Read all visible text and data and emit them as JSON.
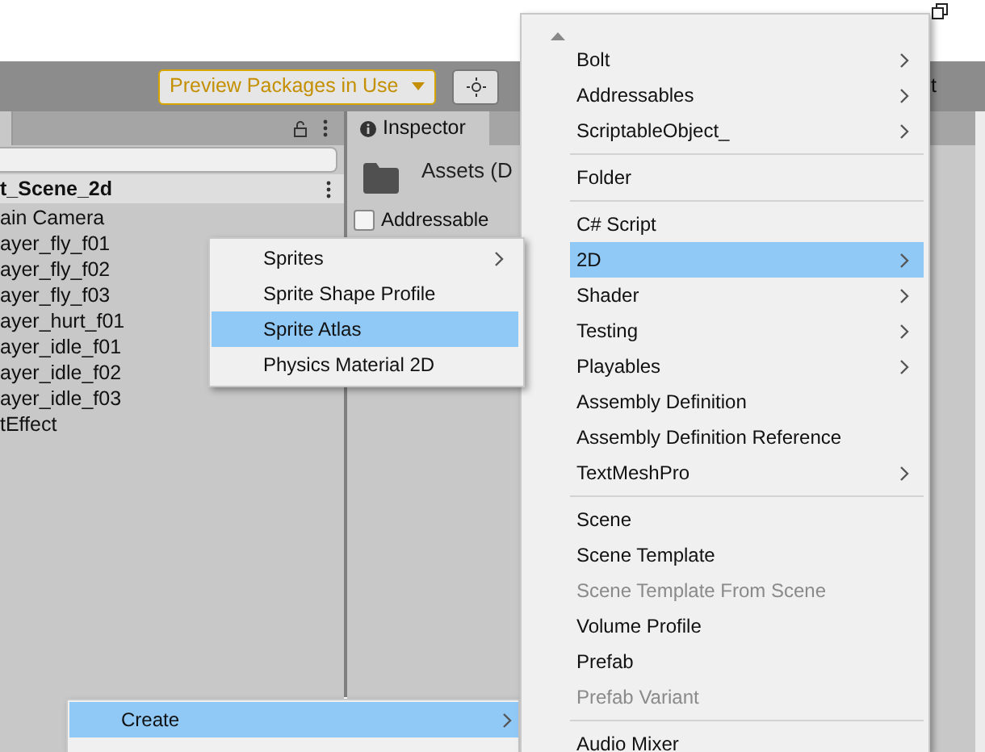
{
  "toolbar": {
    "preview_packages": "Preview Packages in Use",
    "partial_button": "t"
  },
  "hierarchy": {
    "scene": "t_Scene_2d",
    "items": [
      "ain Camera",
      "ayer_fly_f01",
      "ayer_fly_f02",
      "ayer_fly_f03",
      "ayer_hurt_f01",
      "ayer_idle_f01",
      "ayer_idle_f02",
      "ayer_idle_f03",
      "tEffect"
    ]
  },
  "inspector": {
    "tab": "Inspector",
    "title": "Assets (D",
    "addressable": {
      "label": "Addressable",
      "checked": false
    }
  },
  "context_menu": {
    "items": [
      {
        "kind": "item",
        "label": "Create",
        "submenu": true,
        "selected": true,
        "disabled": false
      }
    ]
  },
  "create_menu": {
    "items": [
      {
        "kind": "item",
        "label": "Bolt",
        "submenu": true,
        "selected": false,
        "disabled": false
      },
      {
        "kind": "item",
        "label": "Addressables",
        "submenu": true,
        "selected": false,
        "disabled": false
      },
      {
        "kind": "item",
        "label": "ScriptableObject_",
        "submenu": true,
        "selected": false,
        "disabled": false
      },
      {
        "kind": "separator"
      },
      {
        "kind": "item",
        "label": "Folder",
        "submenu": false,
        "selected": false,
        "disabled": false
      },
      {
        "kind": "separator"
      },
      {
        "kind": "item",
        "label": "C# Script",
        "submenu": false,
        "selected": false,
        "disabled": false
      },
      {
        "kind": "item",
        "label": "2D",
        "submenu": true,
        "selected": true,
        "disabled": false
      },
      {
        "kind": "item",
        "label": "Shader",
        "submenu": true,
        "selected": false,
        "disabled": false
      },
      {
        "kind": "item",
        "label": "Testing",
        "submenu": true,
        "selected": false,
        "disabled": false
      },
      {
        "kind": "item",
        "label": "Playables",
        "submenu": true,
        "selected": false,
        "disabled": false
      },
      {
        "kind": "item",
        "label": "Assembly Definition",
        "submenu": false,
        "selected": false,
        "disabled": false
      },
      {
        "kind": "item",
        "label": "Assembly Definition Reference",
        "submenu": false,
        "selected": false,
        "disabled": false
      },
      {
        "kind": "item",
        "label": "TextMeshPro",
        "submenu": true,
        "selected": false,
        "disabled": false
      },
      {
        "kind": "separator"
      },
      {
        "kind": "item",
        "label": "Scene",
        "submenu": false,
        "selected": false,
        "disabled": false
      },
      {
        "kind": "item",
        "label": "Scene Template",
        "submenu": false,
        "selected": false,
        "disabled": false
      },
      {
        "kind": "item",
        "label": "Scene Template From Scene",
        "submenu": false,
        "selected": false,
        "disabled": true
      },
      {
        "kind": "item",
        "label": "Volume Profile",
        "submenu": false,
        "selected": false,
        "disabled": false
      },
      {
        "kind": "item",
        "label": "Prefab",
        "submenu": false,
        "selected": false,
        "disabled": false
      },
      {
        "kind": "item",
        "label": "Prefab Variant",
        "submenu": false,
        "selected": false,
        "disabled": true
      },
      {
        "kind": "separator"
      },
      {
        "kind": "item",
        "label": "Audio Mixer",
        "submenu": false,
        "selected": false,
        "disabled": false
      }
    ]
  },
  "submenu_2d": {
    "items": [
      {
        "kind": "item",
        "label": "Sprites",
        "submenu": true,
        "selected": false,
        "disabled": false
      },
      {
        "kind": "item",
        "label": "Sprite Shape Profile",
        "submenu": false,
        "selected": false,
        "disabled": false
      },
      {
        "kind": "item",
        "label": "Sprite Atlas",
        "submenu": false,
        "selected": true,
        "disabled": false
      },
      {
        "kind": "item",
        "label": "Physics Material 2D",
        "submenu": false,
        "selected": false,
        "disabled": false
      }
    ]
  }
}
